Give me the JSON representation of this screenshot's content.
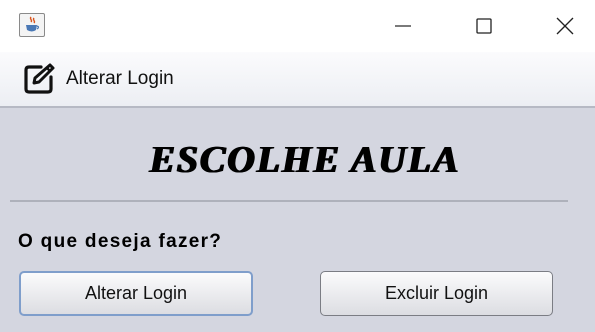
{
  "window": {
    "app_icon": "java-cup-icon",
    "controls": [
      "minimize-icon",
      "maximize-icon",
      "close-icon"
    ]
  },
  "menubar": {
    "item_label": "Alterar Login",
    "item_icon": "edit-icon"
  },
  "main": {
    "heading": "ESCOLHE AULA",
    "question": "O que deseja fazer?",
    "buttons": {
      "alterar_login": "Alterar Login",
      "excluir_login": "Excluir Login"
    }
  },
  "colors": {
    "background": "#d4d6e0",
    "focus_border": "#7f9ecb"
  }
}
